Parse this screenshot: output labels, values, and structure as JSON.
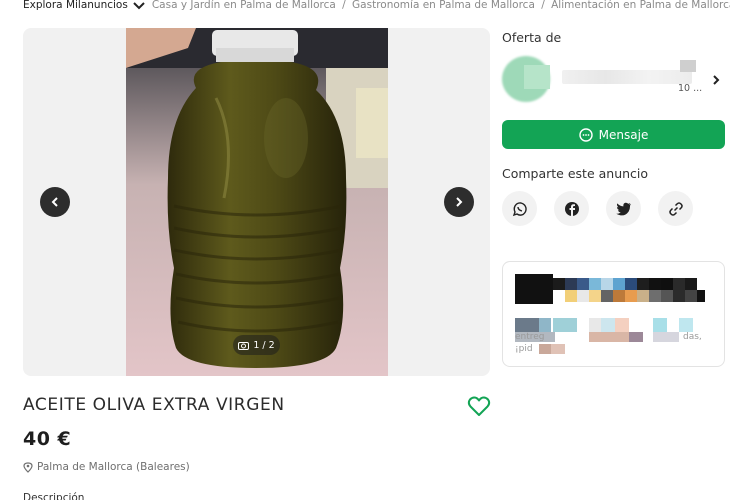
{
  "breadcrumb": {
    "explore_label": "Explora Milanuncios",
    "items": [
      "Casa y Jardín en Palma de Mallorca",
      "Gastronomía en Palma de Mallorca",
      "Alimentación en Palma de Mallorca"
    ],
    "separator": "/"
  },
  "gallery": {
    "counter": "1 / 2",
    "icons": {
      "prev": "chevron-left-icon",
      "next": "chevron-right-icon",
      "counter": "camera-icon"
    }
  },
  "listing": {
    "title": "ACEITE OLIVA EXTRA VIRGEN",
    "price": "40 €",
    "location": "Palma de Mallorca (Baleares)",
    "description_label": "Descripción"
  },
  "seller": {
    "offer_label": "Oferta de",
    "sub_text": "10 ..."
  },
  "actions": {
    "message_label": "Mensaje",
    "share_label": "Comparte este anuncio",
    "share_icons": [
      "whatsapp-icon",
      "facebook-icon",
      "twitter-icon",
      "link-icon"
    ]
  },
  "promo": {
    "text_left_1": "entreg",
    "text_left_2": "¡pid",
    "text_right": "das,"
  },
  "colors": {
    "accent_green": "#13a455",
    "heart_green": "#13a455",
    "nav_button": "#2d2d2d"
  }
}
